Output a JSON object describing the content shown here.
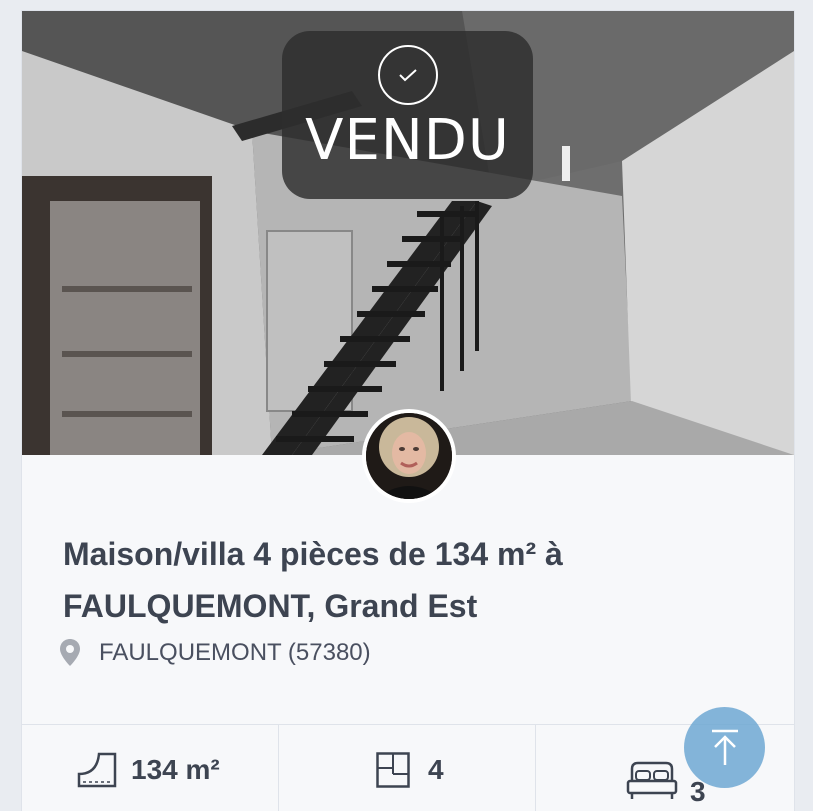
{
  "listing": {
    "status_label": "VENDU",
    "title": "Maison/villa 4 pièces de 134 m² à FAULQUEMONT, Grand Est",
    "location": "FAULQUEMONT (57380)"
  },
  "features": {
    "surface": "134 m²",
    "rooms": "4",
    "bedrooms": "3"
  },
  "colors": {
    "title_text": "#3d4451",
    "badge_bg": "#2d2d2d",
    "scroll_button": "#6ea8d2"
  },
  "icons": [
    "check-icon",
    "location-pin-icon",
    "surface-icon",
    "rooms-icon",
    "bed-icon",
    "arrow-up-icon"
  ]
}
